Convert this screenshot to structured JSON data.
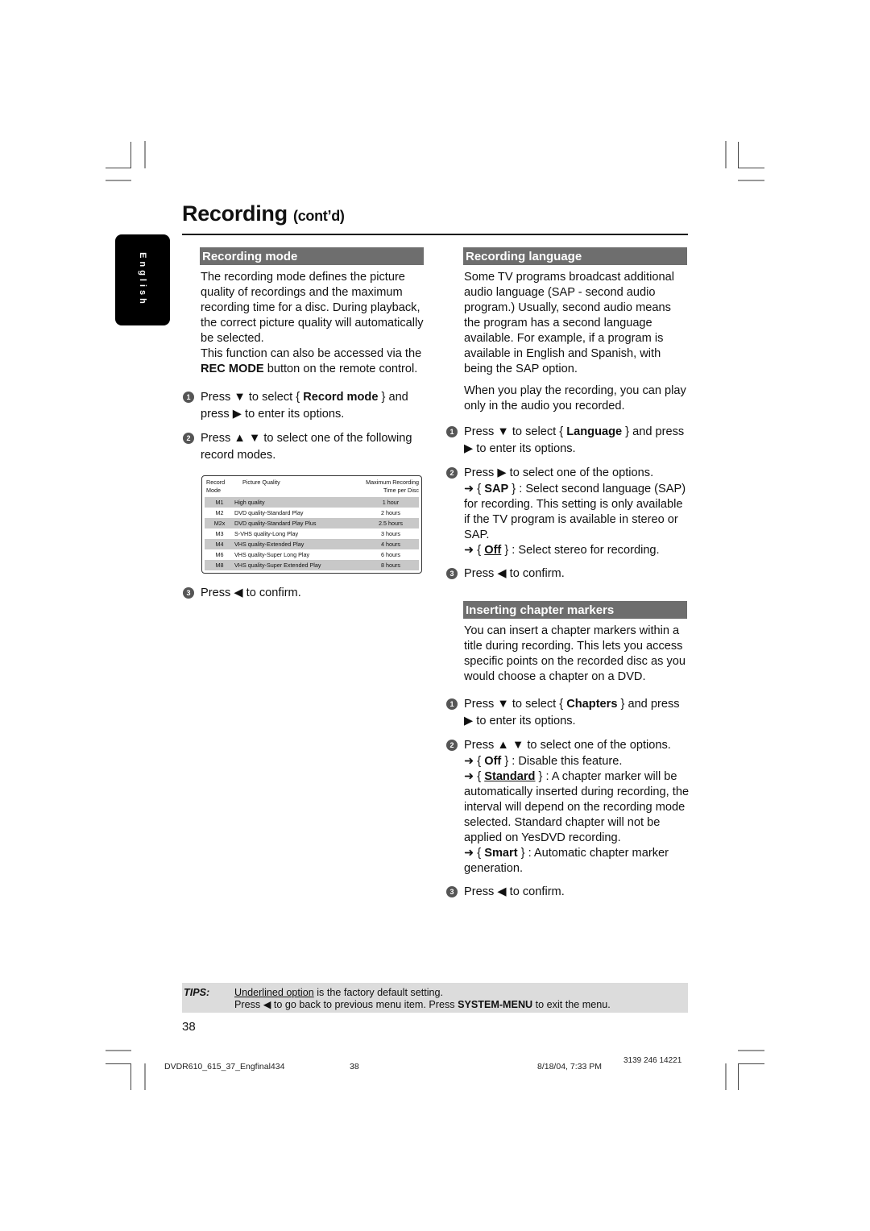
{
  "header": {
    "title": "Recording",
    "subtitle": "(cont’d)"
  },
  "side_tab": {
    "label": "English"
  },
  "recording_mode": {
    "heading": "Recording mode",
    "intro": "The recording mode defines the picture quality of recordings and the maximum recording time for a disc.  During playback, the correct picture quality will automatically be selected.",
    "access_pre": "This function can also be accessed via the ",
    "access_bold": "REC MODE",
    "access_post": " button on the remote control.",
    "steps": [
      {
        "num": "1",
        "pre": "Press ▼ to select { ",
        "bold": "Record mode",
        "post": " } and press ▶ to enter its options."
      },
      {
        "num": "2",
        "text": "Press ▲ ▼ to select one of the following record modes."
      },
      {
        "num": "3",
        "text": "Press ◀  to confirm."
      }
    ],
    "table": {
      "headers": [
        "Record Mode",
        "Picture Quality",
        "Maximum Recording Time per Disc"
      ],
      "header_lines": {
        "c1a": "Record",
        "c1b": "Mode",
        "c2": "Picture Quality",
        "c3a": "Maximum Recording",
        "c3b": "Time per Disc"
      },
      "rows": [
        {
          "mode": "M1",
          "quality": "High quality",
          "time": "1 hour"
        },
        {
          "mode": "M2",
          "quality": "DVD quality-Standard Play",
          "time": "2 hours"
        },
        {
          "mode": "M2x",
          "quality": "DVD quality-Standard Play Plus",
          "time": "2.5 hours"
        },
        {
          "mode": "M3",
          "quality": "S-VHS quality-Long Play",
          "time": "3 hours"
        },
        {
          "mode": "M4",
          "quality": "VHS quality-Extended Play",
          "time": "4 hours"
        },
        {
          "mode": "M6",
          "quality": "VHS quality-Super Long Play",
          "time": "6 hours"
        },
        {
          "mode": "M8",
          "quality": "VHS quality-Super Extended Play",
          "time": "8 hours"
        }
      ]
    }
  },
  "recording_language": {
    "heading": "Recording language",
    "intro": "Some TV programs broadcast additional audio language (SAP - second audio program.) Usually, second audio means the program has a second language available. For example, if a program is available in English and Spanish, with being the SAP option.",
    "note": "When you play the recording, you can play only in the audio you recorded.",
    "step1": {
      "num": "1",
      "pre": "Press ▼ to select { ",
      "bold": "Language",
      "post": " } and press ▶ to enter its options."
    },
    "step2": {
      "num": "2",
      "text": "Press ▶ to select one of the options.",
      "options": [
        {
          "arrow": "➜ { ",
          "name": "SAP",
          "default": false,
          "desc": " } :  Select second language (SAP) for recording.  This setting is only available if the TV program is available in stereo or SAP."
        },
        {
          "arrow": "➜ { ",
          "name": "Off",
          "default": true,
          "desc": " } :  Select stereo for recording."
        }
      ]
    },
    "step3": {
      "num": "3",
      "text": "Press ◀  to confirm."
    }
  },
  "chapter_markers": {
    "heading": "Inserting chapter markers",
    "intro": "You can insert a chapter markers within a title during recording. This lets you access specific points on the recorded disc as you would choose a chapter on a DVD.",
    "step1": {
      "num": "1",
      "pre": "Press ▼ to select { ",
      "bold": "Chapters",
      "post": " } and press ▶ to enter its options."
    },
    "step2": {
      "num": "2",
      "text": "Press ▲ ▼ to select one of the options.",
      "options": [
        {
          "arrow": "➜ { ",
          "name": "Off",
          "default": false,
          "desc": " } :  Disable this feature."
        },
        {
          "arrow": "➜ { ",
          "name": "Standard",
          "default": true,
          "desc": " } :  A chapter marker will be automatically inserted during recording, the interval will depend on the recording mode selected.  Standard chapter will not be applied on YesDVD recording."
        },
        {
          "arrow": "➜ { ",
          "name": "Smart",
          "default": false,
          "desc": " } :  Automatic chapter marker generation."
        }
      ]
    },
    "step3": {
      "num": "3",
      "text": "Press ◀  to confirm."
    }
  },
  "tips": {
    "label": "TIPS:",
    "line1_underlined": "Underlined option",
    "line1_rest": " is the factory default setting.",
    "line2_pre": "Press ◀ to go back to previous menu item.  Press ",
    "line2_bold": "SYSTEM-MENU",
    "line2_post": " to exit the menu."
  },
  "page_number": "38",
  "footer": {
    "file": "DVDR610_615_37_Engfinal434",
    "page": "38",
    "datetime": "8/18/04, 7:33 PM",
    "code": "3139 246 14221"
  }
}
